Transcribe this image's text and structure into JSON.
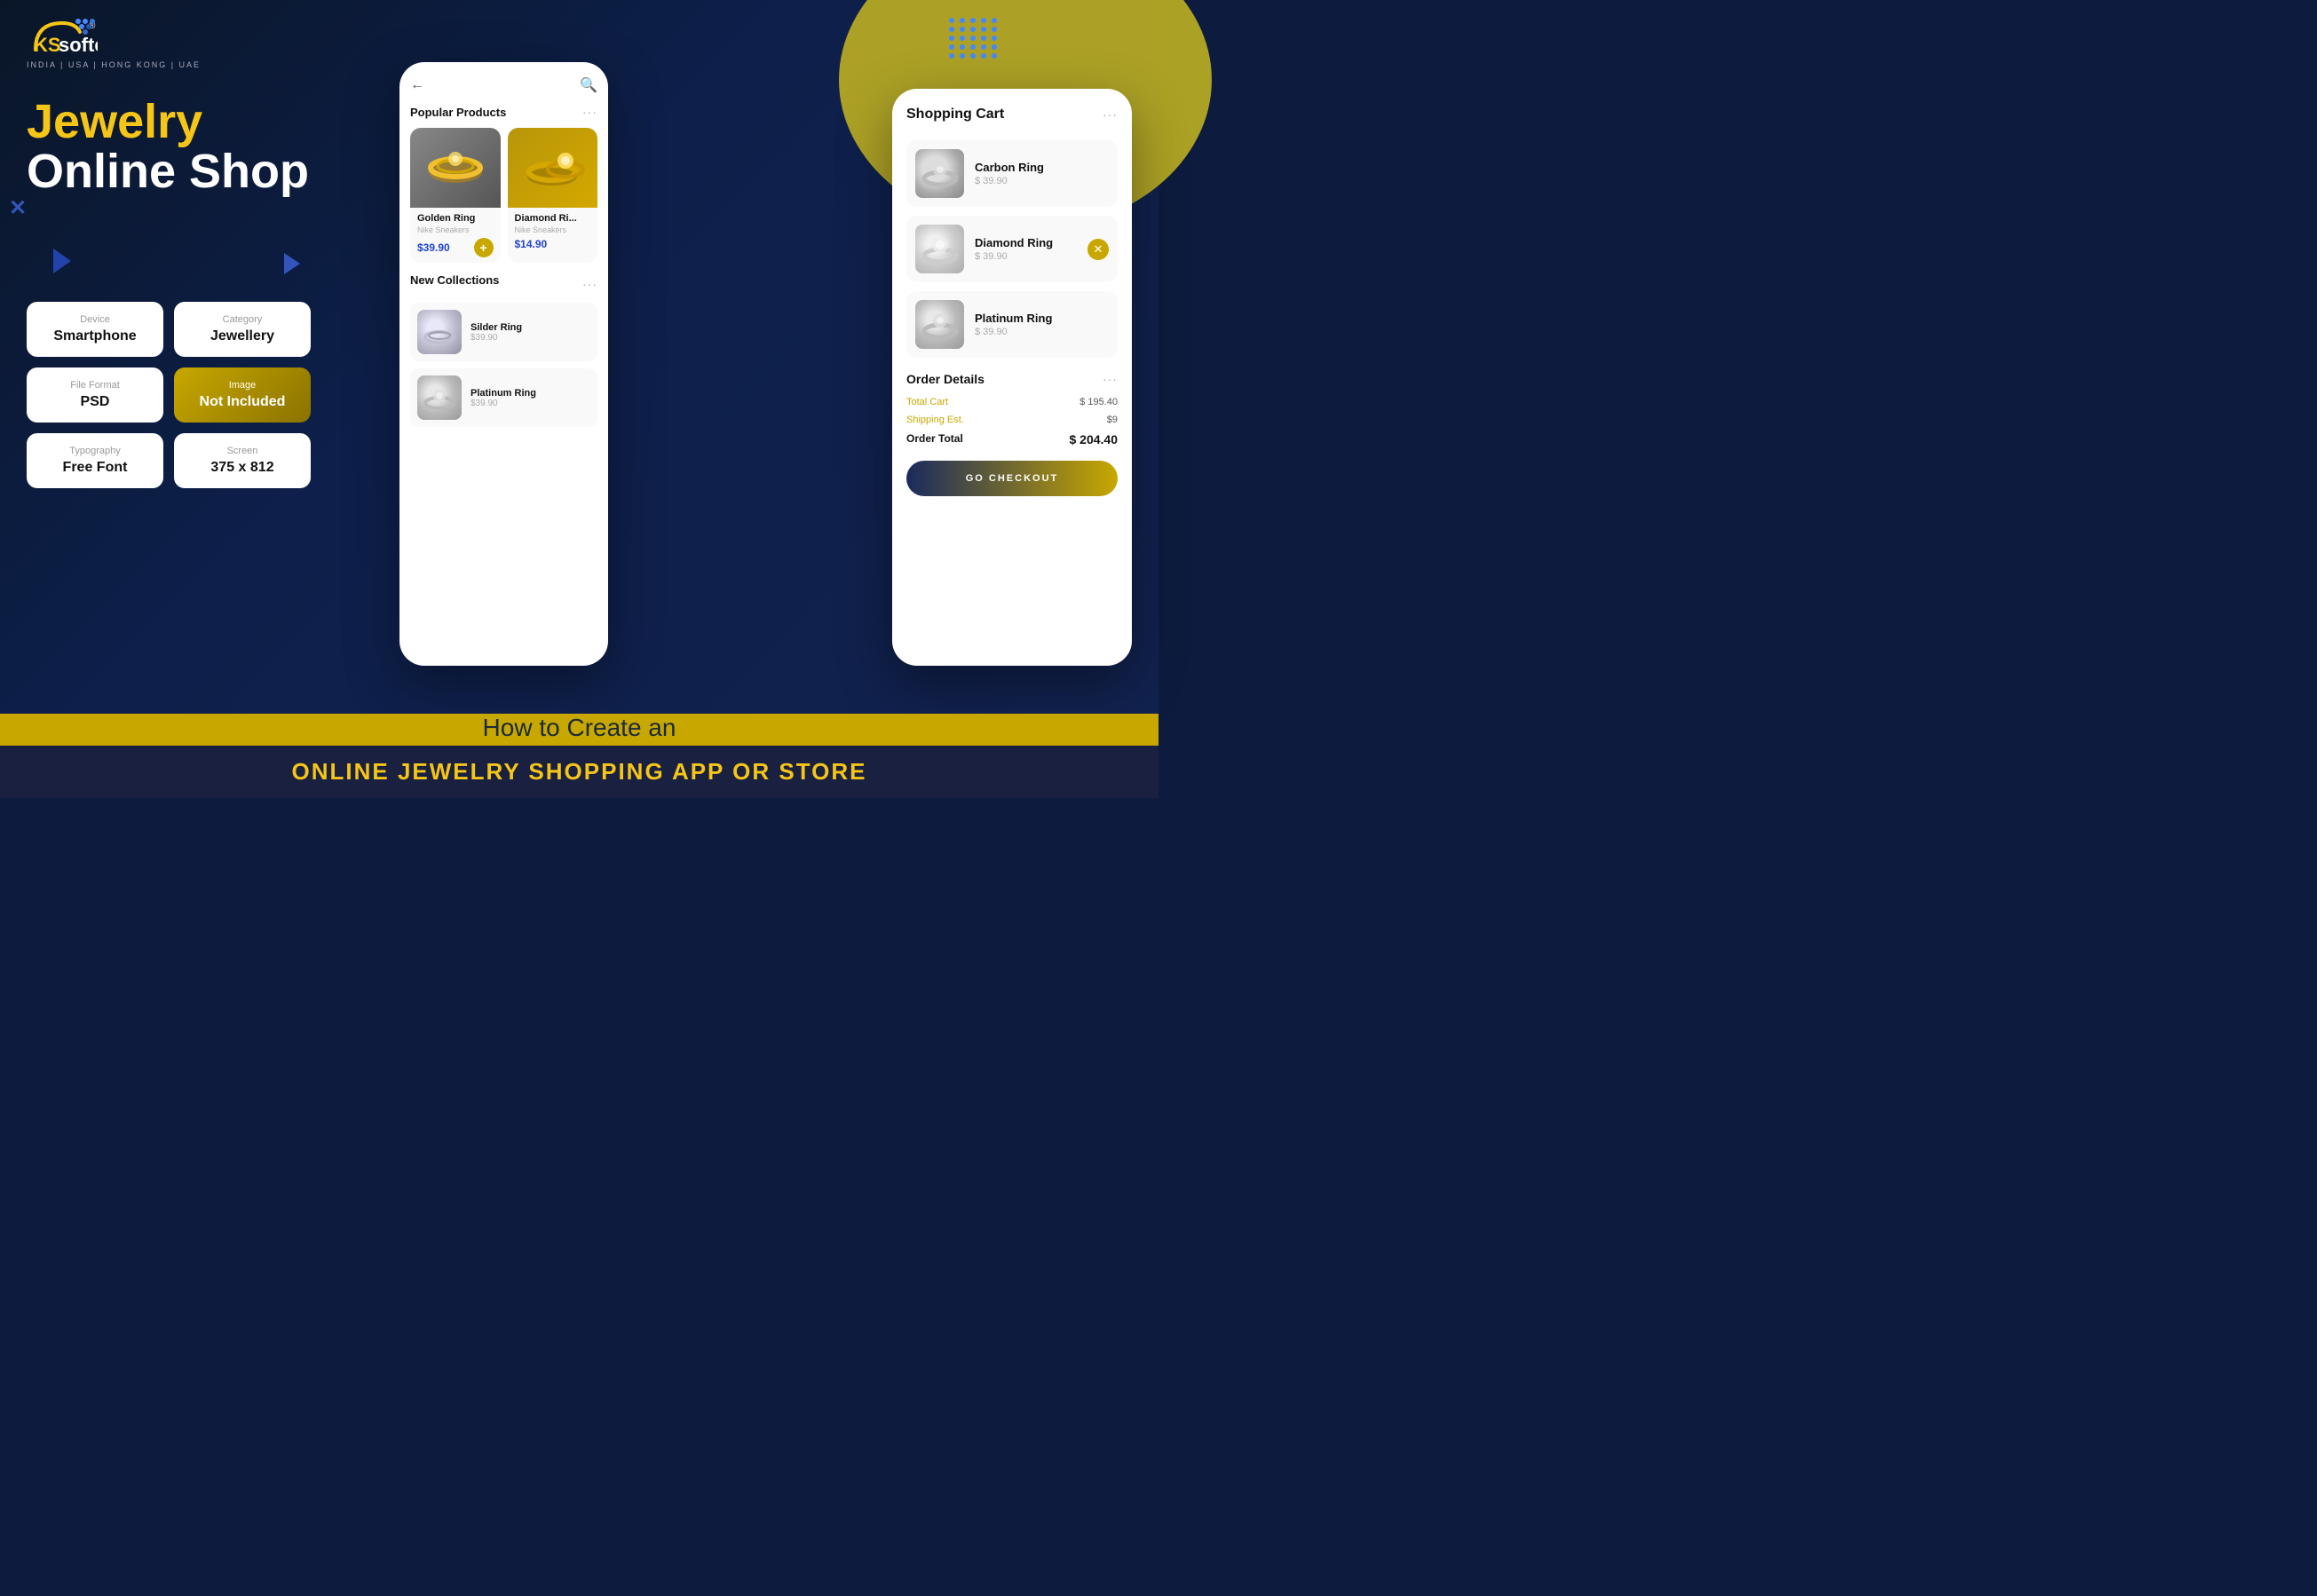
{
  "brand": {
    "name_ks": "KS",
    "name_softech": "softech",
    "tagline": "INDIA | USA | HONG KONG | UAE",
    "registered": "®"
  },
  "hero": {
    "line1": "Jewelry",
    "line2": "Online Shop"
  },
  "info_cards": [
    {
      "id": "device",
      "label": "Device",
      "value": "Smartphone",
      "dark": false
    },
    {
      "id": "category",
      "label": "Category",
      "value": "Jewellery",
      "dark": false
    },
    {
      "id": "file-format",
      "label": "File Format",
      "value": "PSD",
      "dark": false
    },
    {
      "id": "image",
      "label": "Image",
      "value": "Not Included",
      "dark": true
    },
    {
      "id": "typography",
      "label": "Typography",
      "value": "Free Font",
      "dark": false
    },
    {
      "id": "screen",
      "label": "Screen",
      "value": "375 x 812",
      "dark": false
    }
  ],
  "phone1": {
    "section1": {
      "title": "Popular Products",
      "more": "···"
    },
    "products": [
      {
        "name": "Golden Ring",
        "brand": "Nike Sneakers",
        "price": "$39.90",
        "has_add": true
      },
      {
        "name": "Diamond Ri...",
        "brand": "Nike Sneakers",
        "price": "$14.90",
        "has_add": false
      }
    ],
    "section2": {
      "title": "New Collections",
      "more": "···"
    },
    "collections": [
      {
        "name": "Silder Ring",
        "price": "$39.90"
      },
      {
        "name": "Platinum Ring",
        "price": "$39.90"
      }
    ]
  },
  "phone2": {
    "title": "Shopping Cart",
    "more": "···",
    "items": [
      {
        "name": "Carbon Ring",
        "price": "$ 39.90",
        "has_remove": false
      },
      {
        "name": "Diamond Ring",
        "price": "$ 39.90",
        "has_remove": true
      },
      {
        "name": "Platinum Ring",
        "price": "$ 39.90",
        "has_remove": false
      }
    ],
    "order_details": {
      "title": "Order Details",
      "more": "···",
      "total_cart_label": "Total Cart",
      "total_cart_value": "$ 195.40",
      "shipping_label": "Shipping Est.",
      "shipping_value": "$9",
      "order_total_label": "Order Total",
      "order_total_value": "$ 204.40"
    },
    "checkout_btn": "GO CHECKOUT"
  },
  "bottom": {
    "how_to": "How to Create an",
    "banner": "ONLINE JEWELRY SHOPPING APP OR STORE"
  },
  "colors": {
    "accent_yellow": "#f5c518",
    "dark_navy": "#0d1b3e",
    "gold": "#c8a800",
    "white": "#ffffff"
  }
}
